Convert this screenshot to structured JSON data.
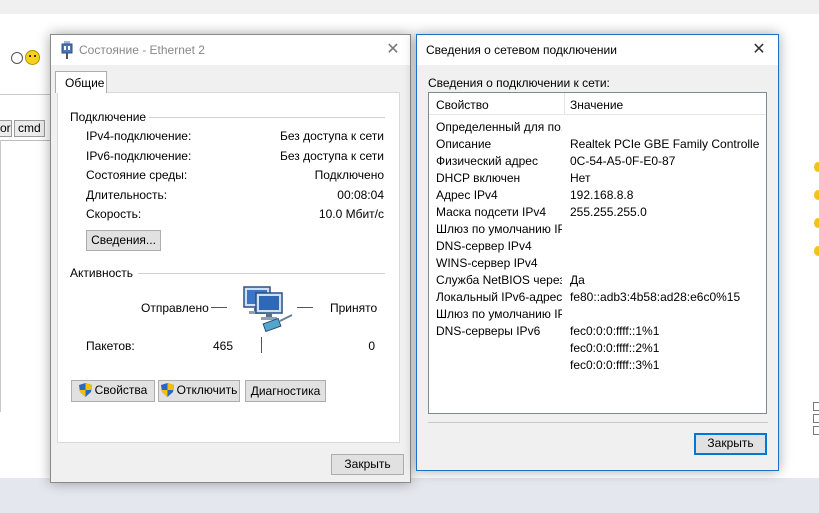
{
  "background": {
    "buttons": [
      "or",
      "cmd"
    ]
  },
  "status_window": {
    "title": "Состояние - Ethernet 2",
    "tab": "Общие",
    "connection_section": "Подключение",
    "rows": [
      {
        "label": "IPv4-подключение:",
        "value": "Без доступа к сети"
      },
      {
        "label": "IPv6-подключение:",
        "value": "Без доступа к сети"
      },
      {
        "label": "Состояние среды:",
        "value": "Подключено"
      },
      {
        "label": "Длительность:",
        "value": "00:08:04"
      },
      {
        "label": "Скорость:",
        "value": "10.0 Мбит/с"
      }
    ],
    "details_button": "Сведения...",
    "activity_section": "Активность",
    "sent_label": "Отправлено",
    "received_label": "Принято",
    "packets_label": "Пакетов:",
    "packets_sent": "465",
    "packets_received": "0",
    "properties_button": "Свойства",
    "disable_button": "Отключить",
    "diagnose_button": "Диагностика",
    "close_button": "Закрыть"
  },
  "details_window": {
    "title": "Сведения о сетевом подключении",
    "subtitle": "Сведения о подключении к сети:",
    "col_property": "Свойство",
    "col_value": "Значение",
    "rows": [
      {
        "prop": "Определенный для по...",
        "val": ""
      },
      {
        "prop": "Описание",
        "val": "Realtek PCIe GBE Family Controller"
      },
      {
        "prop": "Физический адрес",
        "val": "0C-54-A5-0F-E0-87"
      },
      {
        "prop": "DHCP включен",
        "val": "Нет"
      },
      {
        "prop": "Адрес IPv4",
        "val": "192.168.8.8"
      },
      {
        "prop": "Маска подсети IPv4",
        "val": "255.255.255.0"
      },
      {
        "prop": "Шлюз по умолчанию IP",
        "val": ""
      },
      {
        "prop": "DNS-сервер IPv4",
        "val": ""
      },
      {
        "prop": "WINS-сервер IPv4",
        "val": ""
      },
      {
        "prop": "Служба NetBIOS через...",
        "val": "Да"
      },
      {
        "prop": "Локальный IPv6-адрес...",
        "val": "fe80::adb3:4b58:ad28:e6c0%15"
      },
      {
        "prop": "Шлюз по умолчанию IP",
        "val": ""
      },
      {
        "prop": "DNS-серверы IPv6",
        "val": "fec0:0:0:ffff::1%1"
      },
      {
        "prop": "",
        "val": "fec0:0:0:ffff::2%1"
      },
      {
        "prop": "",
        "val": "fec0:0:0:ffff::3%1"
      }
    ],
    "close_button": "Закрыть"
  },
  "colors": {
    "accent": "#0078d7",
    "window_bg": "#f0f0f0"
  }
}
